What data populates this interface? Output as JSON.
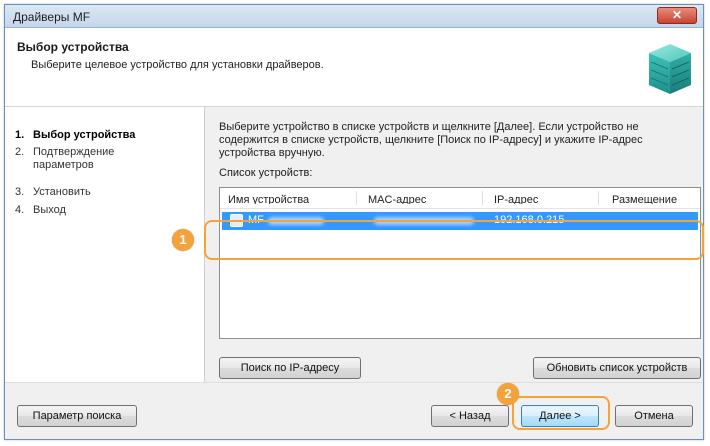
{
  "window": {
    "title": "Драйверы MF",
    "close_label": "✕"
  },
  "header": {
    "title": "Выбор устройства",
    "subtitle": "Выберите целевое устройство для установки драйверов.",
    "icon": "printer-device-icon"
  },
  "steps": [
    {
      "num": "1.",
      "label": "Выбор устройства",
      "active": true
    },
    {
      "num": "2.",
      "label": "Подтверждение параметров",
      "active": false
    },
    {
      "num": "3.",
      "label": "Установить",
      "active": false
    },
    {
      "num": "4.",
      "label": "Выход",
      "active": false
    }
  ],
  "main": {
    "instructions": "Выберите устройство в списке устройств и щелкните [Далее]. Если устройство не содержится в списке устройств, щелкните [Поиск по IP-адресу] и укажите IP-адрес устройства вручную.",
    "list_label": "Список устройств:",
    "columns": [
      "Имя устройства",
      "MAC-адрес",
      "IP-адрес",
      "Размещение"
    ],
    "rows": [
      {
        "name": "MF",
        "mac": "",
        "ip": "192.168.0.215",
        "location": ""
      }
    ],
    "search_ip_button": "Поиск по IP-адресу",
    "refresh_button": "Обновить список устройств"
  },
  "footer": {
    "search_params_button": "Параметр поиска",
    "back_button": "< Назад",
    "next_button": "Далее >",
    "cancel_button": "Отмена"
  },
  "callouts": [
    "1",
    "2"
  ],
  "colors": {
    "selection": "#3399ff",
    "callout": "#f3a33c",
    "close_button": "#c74431"
  }
}
